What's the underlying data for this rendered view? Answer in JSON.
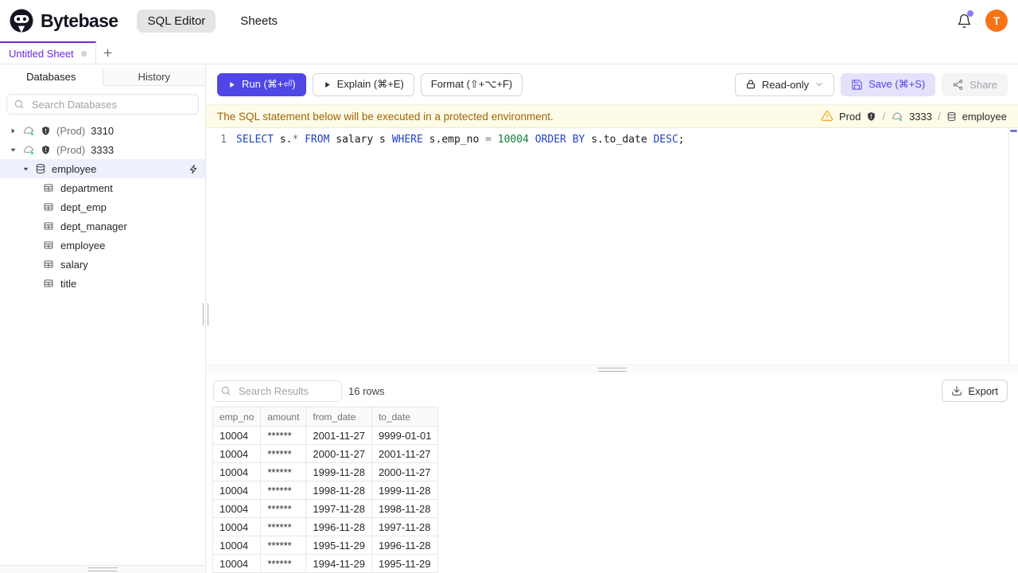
{
  "topbar": {
    "brand": "Bytebase",
    "nav_sql_editor": "SQL Editor",
    "nav_sheets": "Sheets",
    "avatar_initial": "T"
  },
  "sheet_tabs": {
    "active_tab": "Untitled Sheet"
  },
  "sidebar": {
    "tab_databases": "Databases",
    "tab_history": "History",
    "search_placeholder": "Search Databases",
    "instances": [
      {
        "env": "(Prod)",
        "name": "3310"
      },
      {
        "env": "(Prod)",
        "name": "3333"
      }
    ],
    "database": {
      "name": "employee"
    },
    "tables": [
      "department",
      "dept_emp",
      "dept_manager",
      "employee",
      "salary",
      "title"
    ]
  },
  "toolbar": {
    "run": "Run (⌘+⏎)",
    "explain": "Explain (⌘+E)",
    "format": "Format (⇧+⌥+F)",
    "readonly": "Read-only",
    "save": "Save (⌘+S)",
    "share": "Share"
  },
  "banner": {
    "message": "The SQL statement below will be executed in a protected environment.",
    "env": "Prod",
    "instance": "3333",
    "database": "employee",
    "sep": "/"
  },
  "editor": {
    "line_number": "1",
    "sql": "SELECT s.* FROM salary s WHERE s.emp_no = 10004 ORDER BY s.to_date DESC;",
    "tokens": [
      {
        "text": "SELECT",
        "type": "keyword"
      },
      {
        "text": " s.",
        "type": "plain"
      },
      {
        "text": "*",
        "type": "operator"
      },
      {
        "text": " ",
        "type": "plain"
      },
      {
        "text": "FROM",
        "type": "keyword"
      },
      {
        "text": " salary s ",
        "type": "plain"
      },
      {
        "text": "WHERE",
        "type": "keyword"
      },
      {
        "text": " s.emp_no ",
        "type": "plain"
      },
      {
        "text": "=",
        "type": "operator"
      },
      {
        "text": " ",
        "type": "plain"
      },
      {
        "text": "10004",
        "type": "number"
      },
      {
        "text": " ",
        "type": "plain"
      },
      {
        "text": "ORDER BY",
        "type": "keyword"
      },
      {
        "text": " s.to_date ",
        "type": "plain"
      },
      {
        "text": "DESC",
        "type": "keyword"
      },
      {
        "text": ";",
        "type": "plain"
      }
    ]
  },
  "results": {
    "search_placeholder": "Search Results",
    "row_count": "16 rows",
    "export": "Export",
    "columns": [
      "emp_no",
      "amount",
      "from_date",
      "to_date"
    ],
    "rows": [
      [
        "10004",
        "******",
        "2001-11-27",
        "9999-01-01"
      ],
      [
        "10004",
        "******",
        "2000-11-27",
        "2001-11-27"
      ],
      [
        "10004",
        "******",
        "1999-11-28",
        "2000-11-27"
      ],
      [
        "10004",
        "******",
        "1998-11-28",
        "1999-11-28"
      ],
      [
        "10004",
        "******",
        "1997-11-28",
        "1998-11-28"
      ],
      [
        "10004",
        "******",
        "1996-11-28",
        "1997-11-28"
      ],
      [
        "10004",
        "******",
        "1995-11-29",
        "1996-11-28"
      ],
      [
        "10004",
        "******",
        "1994-11-29",
        "1995-11-29"
      ]
    ]
  },
  "colors": {
    "accent": "#4f46e5",
    "accent-soft": "#e4e1fb",
    "tab-purple": "#6d28d9",
    "avatar-orange": "#f97316",
    "notif-dot": "#8b7cf6",
    "banner-bg": "#fefce8",
    "banner-text": "#a16207",
    "warning": "#f59e0b",
    "keyword": "#2142c8",
    "number": "#15803d",
    "operator": "#6b7280",
    "selected-row": "#eef0fc",
    "green-dot": "#34d399"
  }
}
